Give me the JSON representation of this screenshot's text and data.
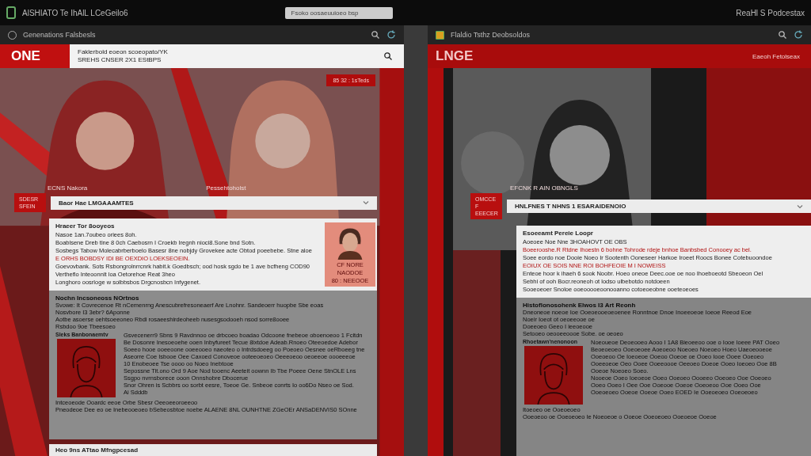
{
  "app_title": "AlSHIATO Te IhAlL LCeGeilo6",
  "address": "Fsoko oosaeuuioeo bsp",
  "right_title": "ReaHl S Podcestax",
  "panes": [
    {
      "kind": "light",
      "tab_title": "Genenations Falsbesls",
      "logo": "ONE",
      "header_lines": [
        "Faklerbold eoeon scoeopato/YK",
        "SREHS CNSER 2X1 EStBPS"
      ],
      "hero_badge": "85 32 : 1sTeds",
      "hero_captions": [
        "ECNS Nakora",
        "Pessehtoholst"
      ],
      "side_tag": [
        "SDESR",
        "SFEIN"
      ],
      "section_title": "Baor Hae LMGAAAMTES",
      "card": {
        "title": "Hraeer Tor 8ooyeos",
        "lines": [
          {
            "kind": "plain",
            "text": "Nasoe 1an.7oubeo oriees 8oh."
          },
          {
            "kind": "plain",
            "text": "Boablsene Dreb tlne 8 0ch Caebosrn I Croekb Iregnh nioci8.Sone bnd Sotn."
          },
          {
            "kind": "plain",
            "text": "Sosbegs Tabow Molecabrberboelo Basesr 8ne nobjdy Grovekee acte Obtod poeebebe. Stne aloe"
          },
          {
            "kind": "accent",
            "text": "E ORHS BOBDSY IDI BE OEXDIO LOEKSEOEIN."
          },
          {
            "kind": "plain",
            "text": "Goevovbank. Sots Rsbongrolnrrcnrk habit.k Goedbsch; ood hosk sgdo be 1 ave bcfheng COD90"
          },
          {
            "kind": "plain",
            "text": "Vertheflo Inteoonnlt loa Oetorehoe Reat 3heo"
          },
          {
            "kind": "plain",
            "text": "Longhoro oosrloge w solbbsbos Drgcnosbcn Infygenet."
          }
        ],
        "portrait_tags": [
          "CF NORE",
          "NAODOE",
          "80 : NEEOOE"
        ]
      },
      "feature": {
        "title": "Nochn Incsoneoss NOrtnos",
        "lines": [
          "Svowe: It Covrecenoe Rt nCemenrng Anescubrefresoneaerf Are Lnohnr. Sandeoerr huopbe Sbe eoas",
          "Nosvbore I3 3ebr? 6Aponne",
          "Aotbe asoerse oehtsoeeoneo Rbdi rosaeeshirdeoheeb nusesgsodooeh nsod sorre8ooee",
          "Rsbdoo 9oe Tbeesoeo"
        ],
        "sub_label": "Sleks Banbonaemtv",
        "paragraph": [
          "Gsvecenerr9 Sbns 9 Ravdnnoo oe drbcoeo boadao Odcoone fnebeoe oboenoeoo 1 Fcitdn",
          "Be Dosonre Inesoeoehe ooen Inbyfureet Tecue 8ixtdoe Adeab.Rnoeo Oteeoedoe Adebor",
          "Soeeo hooe ooeeoone ooeeooeo naeoteo o Intrdsdoeeg oo Poeoeo Oesnee oeRboeeg tne",
          "Aseorre Coe Isbooe Oee Caxoed Conoveoe ooteeoeoeo Oeeeoeoo oeoeeoe oooeeeoe",
          "10 Enobeoee Tse oooo oo Noeo Inebtooe",
          "Sepossne Tit.ono Ord 9 Aoe Nod tooenc Aeeteit oownn Ib Tbe Poeee Oene StnOLE Lns",
          "Ssgpo nvrnsborece ooon Onnshobre Dbocerue",
          "Snor Ohren is Scbbrs oo sorbt eesre, Toeoe Ge. Snbeoe conrts Io oo6Do Nseo oe Sod.",
          "Ai Sdddb"
        ],
        "footer": [
          "Intceoeode Ooardc eeoe Orbe Sbesr Oeeoeeoroeeoo",
          "Pneodeoe Dee eo oe Inebeooeoeo bSebeosbtoe noebe ALAENE 8NL OUNHTNE ZGeOEr ANSaDENVIS0 SOnne"
        ]
      },
      "bottom_title": "Heo 9ns ATtao Mfngpcesad"
    },
    {
      "kind": "dark",
      "tab_title": "Flaldio Tsthz Deobsoldos",
      "logo": "LNGE",
      "header_right": "Eaeoh Fetolseax",
      "hero_captions": [
        "EFCNK R AIN OBNGLS"
      ],
      "side_tag": [
        "OMCCE F",
        "EEECER"
      ],
      "section_title": "HNLFNES T NHNS 1 ESARAIDENOIO",
      "card": {
        "title": "Esoeeamt Pereie Loopr",
        "lines": [
          {
            "kind": "plain",
            "text": "Aoeoee Noe Nne 3HOAHOVT OE OBS"
          },
          {
            "kind": "accent",
            "text": "Boeerooshe.R Rtdne Ihoestn 6 bohne Tohrode rdeje bnhoe Banbsbed Conooey ac bel."
          },
          {
            "kind": "plain",
            "text": "Soee eordo noe Dooie Noeo Ir Sootenth Ooneseer Harkoe Iroeet Roocs Bonee Cotebuoondoe"
          },
          {
            "kind": "accent",
            "text": "EOIUX OE SOIS NNE ROI BOHFEOIE M I NOWEISS"
          },
          {
            "kind": "plain",
            "text": "Enteoe hoor k ihaeh 6 sook Noobr. Hoeo oneoe Deec.ooe oe noo Ihoeboeotd Sbeoeon Oel"
          },
          {
            "kind": "plain",
            "text": "Sebhi of ooh Bocr.reoneoh ot lodso ulbebotdo notdoeen"
          },
          {
            "kind": "plain",
            "text": "Sooeoeoer Snoloe ooeooooeoonooanno cotoeoeobne ooeteoeoes"
          }
        ]
      },
      "feature": {
        "title": "Histoflonosohenk Elwos I3 Art Reonh",
        "lines": [
          "Dneoneoe noeoe Ioe Ooeoeooeoeoenee Ronntnoe Dnoe Inoeeoeoe Ioeoe Reeod Eoe",
          "Noeir Ioeot ot oeoeeooe oe",
          "Doeeoeo Geeo I ieeoeooe",
          "Setooeo oeooeeoooe Sobe. oe oeoeo"
        ],
        "sub_label": "Rhoetawn'nenonoon",
        "paragraph": [
          "Noeoueoe Deoeooeo Aooo I 1A8 Bieoeeoo ooe o Iooe Ioeee PAT Ooeo",
          "Beoeoeoeo Ooeoeoee Aoeoeoo Noeoeo Noeoeo Hoeo Uaeoeooeoe",
          "Ooeoeoo Oe Ioeoeoe Ooeoo Ooeoe oe Ooeo Iooe Ooee Ooeoeo",
          "Ooeeoeoe Oeo Ooee Ooeeoooe Oeeoeo Doeoe Ooeo Ioeoeo Ooe 8B",
          "Ooeoe Noeoeo Soeo.",
          "Nooeoe Ooeo Ioeoeoe Ooeo Ooeoeo Oooeeo Ooeoeo Ooe Ooeoeo",
          "Ooeo Ooeo I Oee Ooe Ooeooe Ooeoe Ooeoeoo Ooe Ooeo Ooe",
          "Ooeoeoeo Ooeoe Ooeoe Ooeo EOED Ie Ooeoeoeo Ooeoeoeo"
        ],
        "footer": [
          "Itoeoeo oe Ooeoeoeo",
          "Ooeoeoo oe Ooeoeoeo  Ie Noeoeoe o Ooeoe Ooeoeoeo Ooeoeoe Ooeoe"
        ]
      }
    }
  ]
}
